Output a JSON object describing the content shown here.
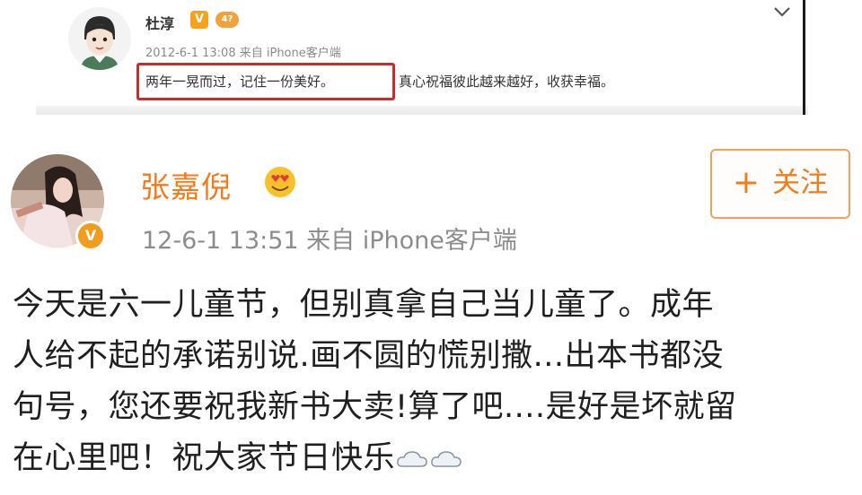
{
  "top_post": {
    "username": "杜淳",
    "verified_badge": "V",
    "level_badge": "4?",
    "meta": "2012-6-1 13:08 来自 iPhone客户端",
    "text_highlighted": "两年一晃而过，记住一份美好。",
    "text_rest": "真心祝福彼此越来越好，收获幸福。",
    "icons": {
      "menu": "chevron-down-icon",
      "avatar": "avatar"
    },
    "colors": {
      "highlight_border": "#cc2b2b"
    }
  },
  "main_post": {
    "username": "张嘉倪",
    "verified_badge": "V",
    "meta": "12-6-1 13:51  来自 iPhone客户端",
    "follow": {
      "plus": "+",
      "label": "关注"
    },
    "text_lines": [
      "今天是六一儿童节，但别真拿自己当儿童了。成年",
      "人给不起的承诺别说.画不圆的慌别撒...出本书都没",
      "句号，您还要祝我新书大卖!算了吧....是好是坏就留",
      "在心里吧！祝大家节日快乐"
    ],
    "icons": {
      "username_badge": "heart-eyes-emoji-icon",
      "text_end": "cloud-icon"
    },
    "colors": {
      "username": "#f07c1c",
      "follow_border": "#f0a25a",
      "verified": "#f29b1c"
    }
  }
}
